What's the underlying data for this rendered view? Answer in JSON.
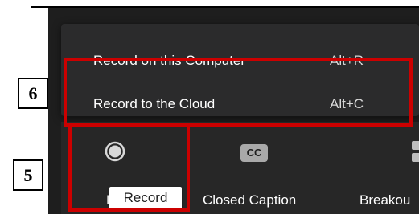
{
  "menu": {
    "items": [
      {
        "label": "Record on this Computer",
        "shortcut": "Alt+R"
      },
      {
        "label": "Record to the Cloud",
        "shortcut": "Alt+C"
      }
    ]
  },
  "toolbar": {
    "items": [
      {
        "label": "Record",
        "visible_label": "R",
        "icon": "record-icon"
      },
      {
        "label": "Closed Caption",
        "icon": "closed-caption-icon",
        "icon_text": "CC"
      },
      {
        "label": "Breakou",
        "icon": "breakout-rooms-icon"
      }
    ]
  },
  "tooltip": {
    "text": "Record"
  },
  "callouts": [
    {
      "number": "6",
      "target": "record-to-cloud-menu-item"
    },
    {
      "number": "5",
      "target": "record-button"
    }
  ],
  "colors": {
    "highlight": "#cc0000",
    "menu_background": "#2b2b2c",
    "toolbar_background": "#272727",
    "text": "#ffffff"
  }
}
